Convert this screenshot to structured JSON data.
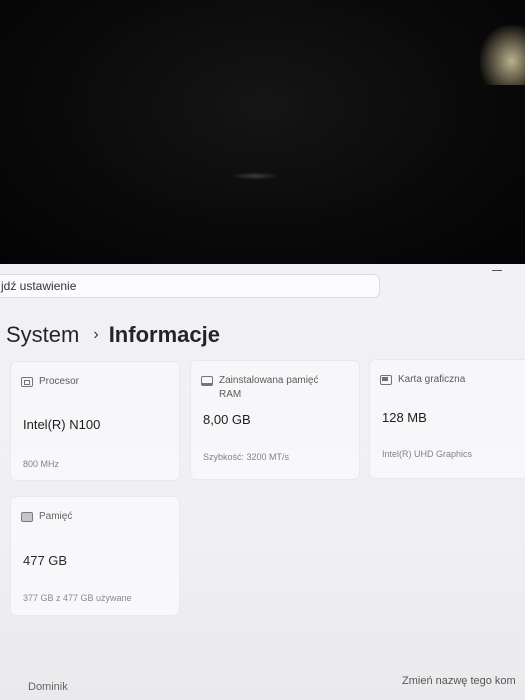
{
  "search": {
    "text": "jdź ustawienie"
  },
  "breadcrumb": {
    "root": "System",
    "separator": "›",
    "page": "Informacje"
  },
  "cards": {
    "processor": {
      "label": "Procesor",
      "value": "Intel(R) N100",
      "detail": "800 MHz"
    },
    "ram": {
      "label_line1": "Zainstalowana pamięć",
      "label_line2": "RAM",
      "value": "8,00 GB",
      "detail": "Szybkość: 3200 MT/s"
    },
    "graphics": {
      "label": "Karta graficzna",
      "value": "128 MB",
      "detail": "Intel(R) UHD Graphics"
    },
    "storage": {
      "label": "Pamięć",
      "value": "477 GB",
      "detail": "377 GB z 477 GB używane"
    }
  },
  "footer": {
    "device_name": "Dominik",
    "rename_label": "Zmień nazwę tego kom"
  },
  "icons": [
    "cpu-icon",
    "ram-icon",
    "gpu-icon",
    "storage-icon",
    "chevron-right-icon",
    "minimize-icon"
  ]
}
